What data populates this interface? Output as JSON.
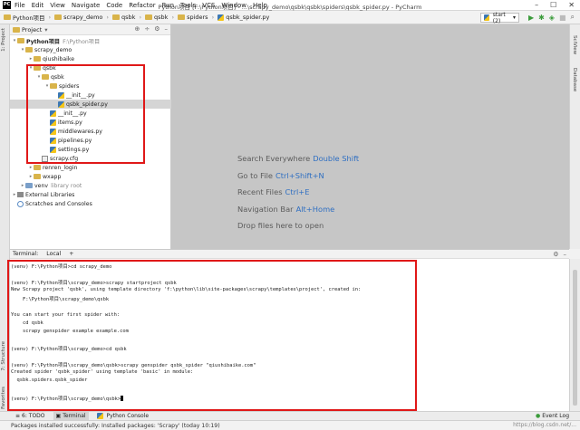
{
  "window": {
    "title": "Python项目 [F:\\Python项目] - ...\\scrapy_demo\\qsbk\\qsbk\\spiders\\qsbk_spider.py - PyCharm",
    "menu": [
      "File",
      "Edit",
      "View",
      "Navigate",
      "Code",
      "Refactor",
      "Run",
      "Tools",
      "VCS",
      "Window",
      "Help"
    ]
  },
  "navbar": {
    "breadcrumbs": [
      "Python项目",
      "scrapy_demo",
      "qsbk",
      "qsbk",
      "spiders",
      "qsbk_spider.py"
    ],
    "run_config": "start (2)"
  },
  "side_tabs": {
    "left_top": "1: Project",
    "left_bottom_1": "7: Structure",
    "left_bottom_2": "2: Favorites",
    "right_1": "SciView",
    "right_2": "Database"
  },
  "project_panel": {
    "title": "Project",
    "tree": [
      {
        "label": "Python项目",
        "note": "F:\\Python项目",
        "depth": 0,
        "kind": "folder",
        "open": true,
        "bold": true
      },
      {
        "label": "scrapy_demo",
        "depth": 1,
        "kind": "folder",
        "open": true
      },
      {
        "label": "qiushibaike",
        "depth": 2,
        "kind": "folder",
        "open": false
      },
      {
        "label": "qsbk",
        "depth": 2,
        "kind": "folder",
        "open": true
      },
      {
        "label": "qsbk",
        "depth": 3,
        "kind": "folder",
        "open": true
      },
      {
        "label": "spiders",
        "depth": 4,
        "kind": "folder",
        "open": true
      },
      {
        "label": "__init__.py",
        "depth": 5,
        "kind": "py"
      },
      {
        "label": "qsbk_spider.py",
        "depth": 5,
        "kind": "py",
        "selected": true
      },
      {
        "label": "__init__.py",
        "depth": 4,
        "kind": "py"
      },
      {
        "label": "items.py",
        "depth": 4,
        "kind": "py"
      },
      {
        "label": "middlewares.py",
        "depth": 4,
        "kind": "py"
      },
      {
        "label": "pipelines.py",
        "depth": 4,
        "kind": "py"
      },
      {
        "label": "settings.py",
        "depth": 4,
        "kind": "py"
      },
      {
        "label": "scrapy.cfg",
        "depth": 3,
        "kind": "cfg"
      },
      {
        "label": "renren_login",
        "depth": 2,
        "kind": "folder",
        "open": false
      },
      {
        "label": "wxapp",
        "depth": 2,
        "kind": "folder",
        "open": false
      },
      {
        "label": "venv",
        "note": "library root",
        "depth": 1,
        "kind": "folder-blue",
        "open": false
      },
      {
        "label": "External Libraries",
        "depth": 0,
        "kind": "lib",
        "open": false
      },
      {
        "label": "Scratches and Consoles",
        "depth": 0,
        "kind": "scratch"
      }
    ]
  },
  "editor_hints": [
    {
      "text": "Search Everywhere",
      "key": "Double Shift"
    },
    {
      "text": "Go to File",
      "key": "Ctrl+Shift+N"
    },
    {
      "text": "Recent Files",
      "key": "Ctrl+E"
    },
    {
      "text": "Navigation Bar",
      "key": "Alt+Home"
    },
    {
      "text": "Drop files here to open",
      "key": ""
    }
  ],
  "terminal": {
    "header_label": "Terminal:",
    "tab": "Local",
    "add": "+",
    "lines": [
      "(venv) F:\\Python项目>cd scrapy_demo",
      "",
      "(venv) F:\\Python项目\\scrapy_demo>scrapy startproject qsbk",
      "New Scrapy project 'qsbk', using template directory 'f:\\python\\lib\\site-packages\\scrapy\\templates\\project', created in:",
      "    F:\\Python项目\\scrapy_demo\\qsbk",
      "",
      "You can start your first spider with:",
      "    cd qsbk",
      "    scrapy genspider example example.com",
      "",
      "(venv) F:\\Python项目\\scrapy_demo>cd qsbk",
      "",
      "(venv) F:\\Python项目\\scrapy_demo\\qsbk>scrapy genspider qsbk_spider \"qiushibaike.com\"",
      "Created spider 'qsbk_spider' using template 'basic' in module:",
      "  qsbk.spiders.qsbk_spider",
      "",
      "(venv) F:\\Python项目\\scrapy_demo\\qsbk>"
    ]
  },
  "bottom_tabs": {
    "todo": "6: TODO",
    "terminal": "Terminal",
    "python_console": "Python Console",
    "event_log": "Event Log"
  },
  "status": {
    "message": "Packages installed successfully: Installed packages: 'Scrapy' (today 10:19)",
    "watermark": "https://blog.csdn.net/..."
  },
  "colors": {
    "highlight": "#e01818",
    "editor_bg": "#c6c6c6",
    "shortcut": "#2f6fc2"
  }
}
